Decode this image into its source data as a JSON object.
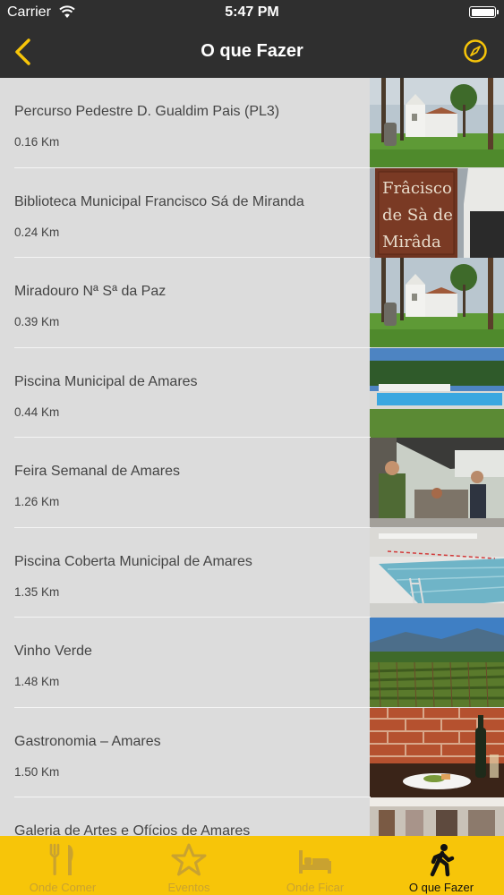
{
  "status_bar": {
    "carrier": "Carrier",
    "time": "5:47 PM"
  },
  "nav": {
    "title": "O que Fazer"
  },
  "items": [
    {
      "name": "Percurso Pedestre D. Gualdim Pais (PL3)",
      "distance": "0.16 Km"
    },
    {
      "name": "Biblioteca Municipal Francisco Sá de Miranda",
      "distance": "0.24 Km",
      "sign_text": [
        "Frâcisco",
        "de Sà de",
        "Mirâda"
      ]
    },
    {
      "name": "Miradouro Nª Sª da Paz",
      "distance": "0.39 Km"
    },
    {
      "name": "Piscina Municipal de Amares",
      "distance": "0.44 Km"
    },
    {
      "name": "Feira Semanal de Amares",
      "distance": "1.26 Km"
    },
    {
      "name": "Piscina Coberta Municipal de Amares",
      "distance": "1.35 Km"
    },
    {
      "name": "Vinho Verde",
      "distance": "1.48 Km"
    },
    {
      "name": "Gastronomia – Amares",
      "distance": "1.50 Km"
    },
    {
      "name": "Galeria de Artes e Ofícios de Amares",
      "distance": ""
    }
  ],
  "tabs": [
    {
      "label": "Onde Comer",
      "icon": "fork-knife-icon"
    },
    {
      "label": "Eventos",
      "icon": "star-icon"
    },
    {
      "label": "Onde Ficar",
      "icon": "bed-icon"
    },
    {
      "label": "O que Fazer",
      "icon": "walking-person-icon",
      "active": true
    }
  ],
  "colors": {
    "bar_background": "#2f2f2f",
    "accent": "#f7c509",
    "list_background": "#dcdcdc"
  }
}
